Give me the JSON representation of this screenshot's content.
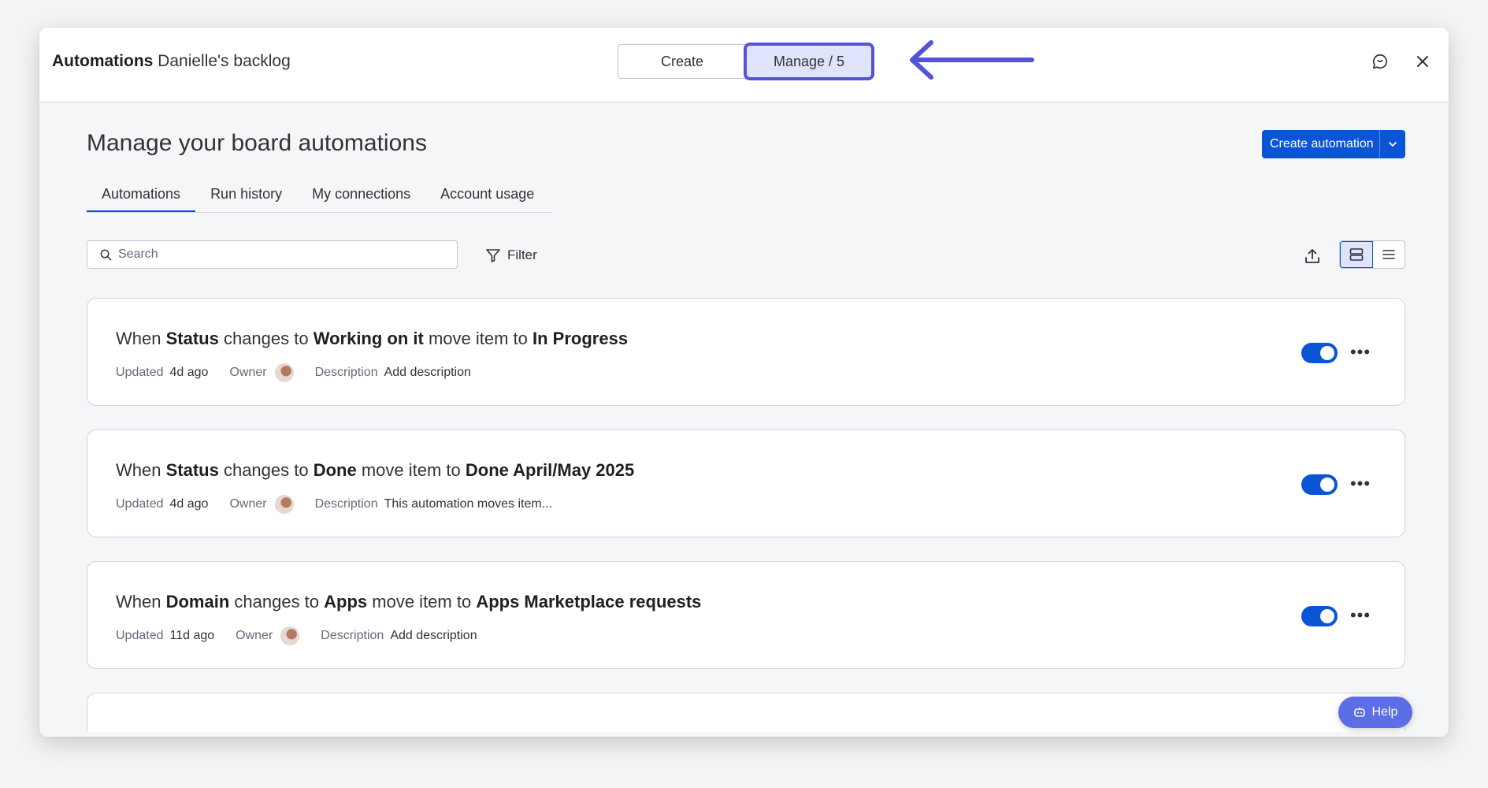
{
  "header": {
    "app_title": "Automations",
    "board_name": "Danielle's backlog",
    "segments": {
      "create": "Create",
      "manage": "Manage / 5"
    },
    "icons": {
      "feedback": "feedback-chat-icon",
      "close": "close-icon",
      "annotation": "left-arrow-icon"
    },
    "annotation_color": "#5453d6"
  },
  "main": {
    "title": "Manage your board automations",
    "create_button": "Create automation",
    "tabs": [
      "Automations",
      "Run history",
      "My connections",
      "Account usage"
    ],
    "active_tab": "Automations",
    "search_placeholder": "Search",
    "filter_label": "Filter",
    "view_mode": "cards"
  },
  "automations": [
    {
      "parts": [
        "When ",
        "Status",
        " changes to ",
        "Working on it",
        " move item to ",
        "In Progress"
      ],
      "updated_label": "Updated",
      "updated": "4d ago",
      "owner_label": "Owner",
      "description_label": "Description",
      "description": "Add description",
      "enabled": true
    },
    {
      "parts": [
        "When ",
        "Status",
        " changes to ",
        "Done",
        " move item to ",
        "Done April/May 2025"
      ],
      "updated_label": "Updated",
      "updated": "4d ago",
      "owner_label": "Owner",
      "description_label": "Description",
      "description": "This automation moves item...",
      "enabled": true
    },
    {
      "parts": [
        "When ",
        "Domain",
        " changes to ",
        "Apps",
        " move item to ",
        "Apps Marketplace requests"
      ],
      "updated_label": "Updated",
      "updated": "11d ago",
      "owner_label": "Owner",
      "description_label": "Description",
      "description": "Add description",
      "enabled": true
    }
  ],
  "help_button": "Help",
  "colors": {
    "primary": "#0a55d6",
    "highlight": "#5453d6",
    "selected_bg": "#dfe4fc",
    "help": "#5b6ee6"
  }
}
